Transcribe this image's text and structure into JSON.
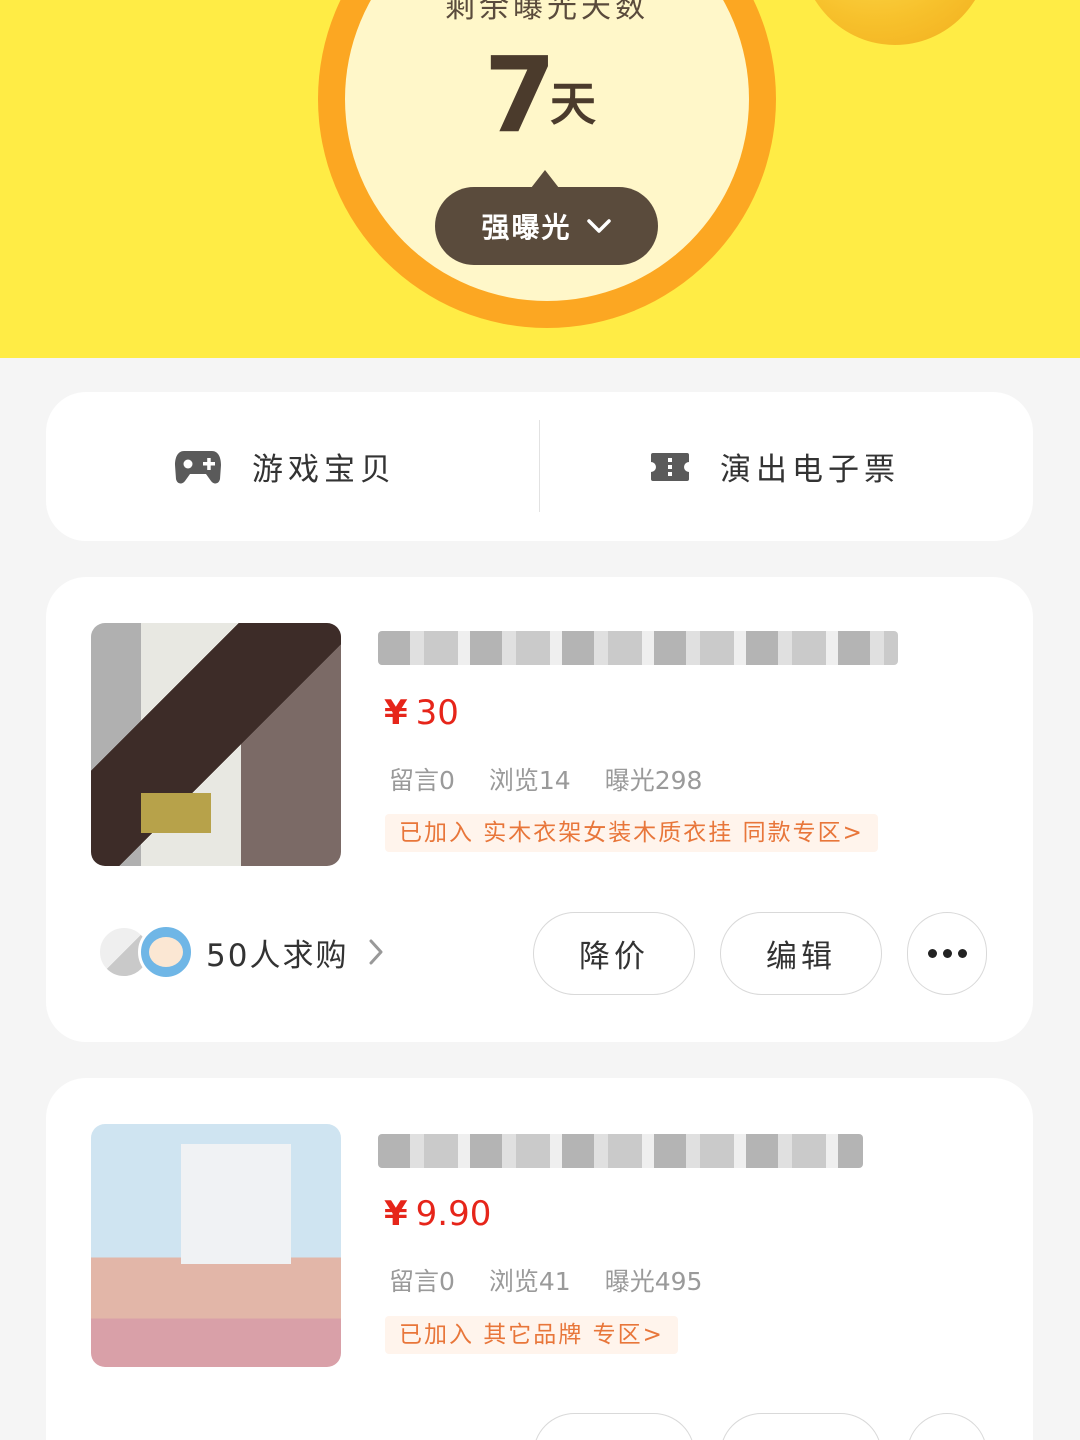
{
  "header": {
    "timer_caption": "剩余曝光天数",
    "days_value": "7",
    "days_unit": "天",
    "boost_label": "强曝光"
  },
  "categories": [
    {
      "label": "游戏宝贝",
      "icon": "gamepad-icon"
    },
    {
      "label": "演出电子票",
      "icon": "ticket-icon"
    }
  ],
  "items": [
    {
      "price_symbol": "¥",
      "price": "30",
      "comments": "留言0",
      "views": "浏览14",
      "exposure": "曝光298",
      "zone": "已加入 实木衣架女装木质衣挂 同款专区>",
      "buyers": "50人求购",
      "btn_reduce_price": "降价",
      "btn_edit": "编辑"
    },
    {
      "price_symbol": "¥",
      "price": "9.90",
      "comments": "留言0",
      "views": "浏览41",
      "exposure": "曝光495",
      "zone": "已加入 其它品牌 专区>"
    }
  ],
  "colors": {
    "header_bg": "#ffec45",
    "timer_ring": "#fca722",
    "price": "#e6251a",
    "zone_tag": "#e8763a"
  }
}
